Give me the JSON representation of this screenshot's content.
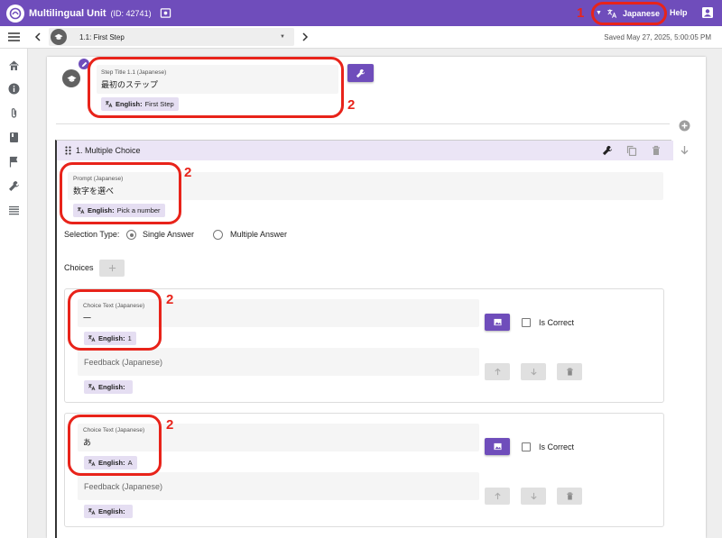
{
  "header": {
    "app_title": "Multilingual Unit",
    "app_id": "(ID: 42741)",
    "language": "Japanese",
    "help": "Help"
  },
  "subheader": {
    "step_selector": "1.1: First Step",
    "saved_text": "Saved May 27, 2025, 5:00:05 PM"
  },
  "step": {
    "title_label": "Step Title 1.1 (Japanese)",
    "title_value": "最初のステップ",
    "english_label": "English:",
    "english_value": "First Step"
  },
  "question": {
    "title": "1. Multiple Choice",
    "prompt_label": "Prompt (Japanese)",
    "prompt_value": "数字を選べ",
    "english_label": "English:",
    "english_value": "Pick a number",
    "selection_type_label": "Selection Type:",
    "single_answer": "Single Answer",
    "multiple_answer": "Multiple Answer",
    "selected_type": "single",
    "choices_label": "Choices"
  },
  "choices": [
    {
      "label": "Choice Text (Japanese)",
      "value": "一",
      "english_label": "English:",
      "english_value": "1",
      "is_correct_label": "Is Correct",
      "is_correct": false,
      "feedback_placeholder": "Feedback (Japanese)",
      "feedback_english_label": "English:",
      "feedback_english_value": ""
    },
    {
      "label": "Choice Text (Japanese)",
      "value": "あ",
      "english_label": "English:",
      "english_value": "A",
      "is_correct_label": "Is Correct",
      "is_correct": false,
      "feedback_placeholder": "Feedback (Japanese)",
      "feedback_english_label": "English:",
      "feedback_english_value": ""
    }
  ],
  "annotations": [
    "1",
    "2",
    "2",
    "2",
    "2"
  ],
  "colors": {
    "primary": "#6f4dbb",
    "header_tint": "#ebe5f6",
    "chip": "#e5def2",
    "annotation": "#e8231a"
  }
}
